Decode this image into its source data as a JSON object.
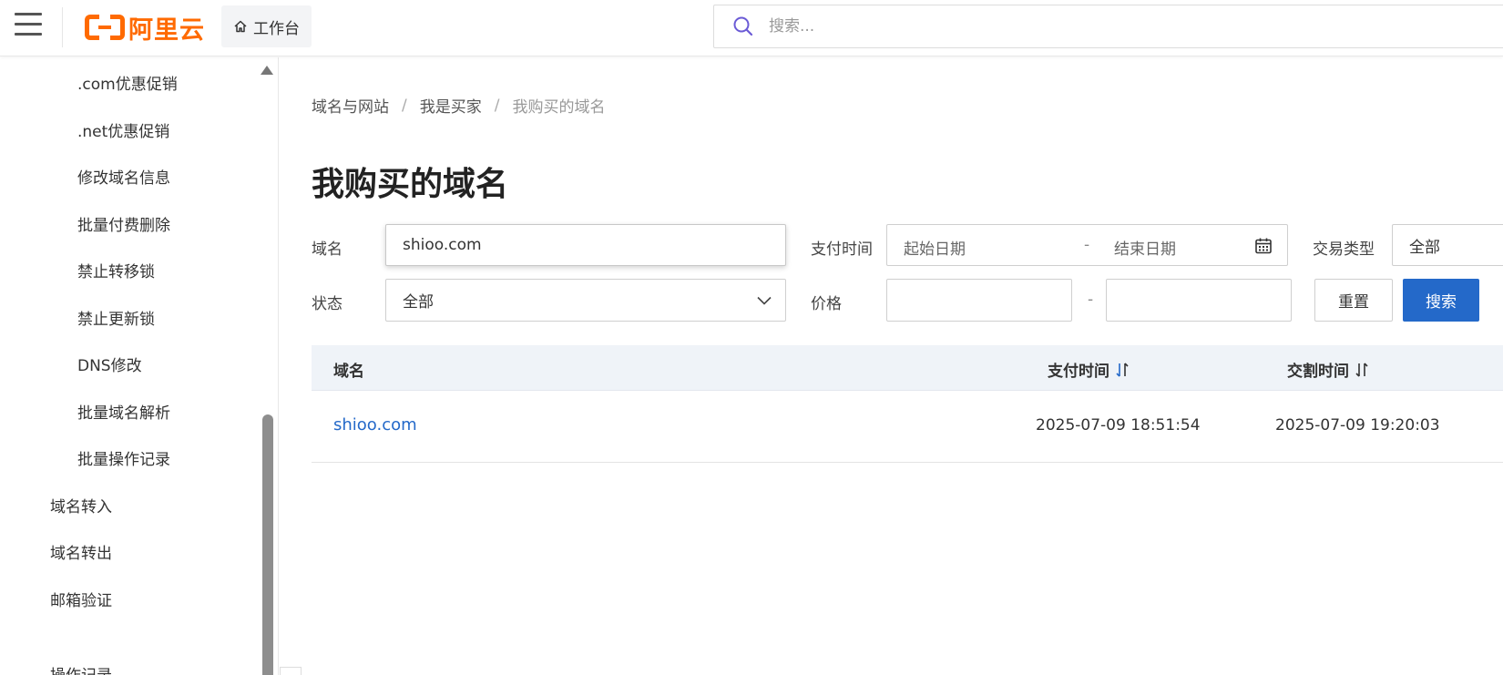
{
  "header": {
    "logo_text": "阿里云",
    "workbench_label": "工作台",
    "search_placeholder": "搜索..."
  },
  "sidebar": {
    "items": [
      {
        "label": ".com优惠促销",
        "level": 2
      },
      {
        "label": ".net优惠促销",
        "level": 2
      },
      {
        "label": "修改域名信息",
        "level": 2
      },
      {
        "label": "批量付费删除",
        "level": 2
      },
      {
        "label": "禁止转移锁",
        "level": 2
      },
      {
        "label": "禁止更新锁",
        "level": 2
      },
      {
        "label": "DNS修改",
        "level": 2
      },
      {
        "label": "批量域名解析",
        "level": 2
      },
      {
        "label": "批量操作记录",
        "level": 2
      },
      {
        "label": "域名转入",
        "level": 1
      },
      {
        "label": "域名转出",
        "level": 1
      },
      {
        "label": "邮箱验证",
        "level": 1
      },
      {
        "label": "操作记录",
        "level": 1
      }
    ]
  },
  "breadcrumb": [
    "域名与网站",
    "我是买家",
    "我购买的域名"
  ],
  "page_title": "我购买的域名",
  "filters": {
    "domain_label": "域名",
    "domain_value": "shioo.com",
    "pay_time_label": "支付时间",
    "start_date_placeholder": "起始日期",
    "end_date_placeholder": "结束日期",
    "date_separator": "-",
    "trade_type_label": "交易类型",
    "trade_type_value": "全部",
    "status_label": "状态",
    "status_value": "全部",
    "price_label": "价格",
    "price_separator": "-",
    "reset_label": "重置",
    "search_label": "搜索"
  },
  "table": {
    "columns": [
      "域名",
      "支付时间",
      "交割时间"
    ],
    "rows": [
      {
        "domain": "shioo.com",
        "pay_time": "2025-07-09 18:51:54",
        "delivery_time": "2025-07-09 19:20:03"
      }
    ]
  },
  "colors": {
    "brand": "#ff6a00",
    "primary": "#2469c9",
    "table_header_bg": "#eff3f8"
  }
}
